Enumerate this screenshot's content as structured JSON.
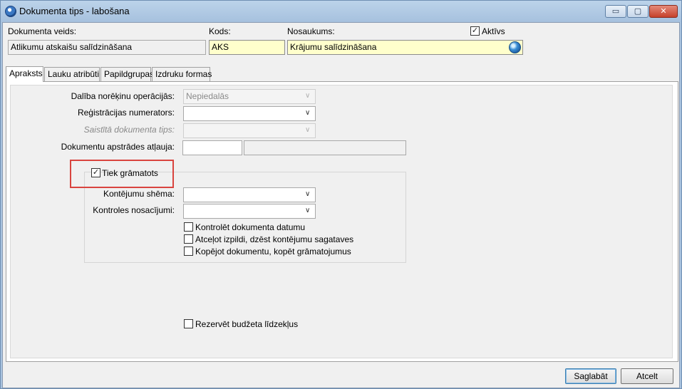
{
  "window": {
    "title": "Dokumenta tips - labošana",
    "minimize": "▭",
    "maximize": "▢",
    "close": "✕"
  },
  "header": {
    "doc_type_label": "Dokumenta veids:",
    "doc_type_value": "Atlikumu atskaišu salīdzināšana",
    "code_label": "Kods:",
    "code_value": "AKS",
    "name_label": "Nosaukums:",
    "name_value": "Krājumu salīdzināšana",
    "active_label": "Aktīvs",
    "active_checked": true
  },
  "tabs": [
    {
      "label": "Apraksts",
      "active": true
    },
    {
      "label": "Lauku atribūti",
      "active": false
    },
    {
      "label": "Papildgrupas",
      "active": false
    },
    {
      "label": "Izdruku formas",
      "active": false
    }
  ],
  "form": {
    "settlement_label": "Dalība norēķinu operācijās:",
    "settlement_value": "Nepiedalās",
    "registration_label": "Reģistrācijas numerators:",
    "registration_value": "",
    "linked_doc_label": "Saistītā dokumenta tips:",
    "linked_doc_value": "",
    "permission_label": "Dokumentu apstrādes atļauja:",
    "permission_code": "",
    "permission_name": ""
  },
  "posting_group": {
    "title": "Tiek grāmatots",
    "checked": true,
    "scheme_label": "Kontējumu shēma:",
    "scheme_value": "",
    "conditions_label": "Kontroles nosacījumi:",
    "conditions_value": "",
    "checks": [
      {
        "label": "Kontrolēt dokumenta datumu",
        "checked": false
      },
      {
        "label": "Atceļot izpildi, dzēst kontējumu sagataves",
        "checked": false
      },
      {
        "label": "Kopējot dokumentu, kopēt grāmatojumus",
        "checked": false
      }
    ]
  },
  "reserve": {
    "label": "Rezervēt budžeta līdzekļus",
    "checked": false
  },
  "buttons": {
    "save": "Saglabāt",
    "cancel": "Atcelt"
  },
  "check_glyph": "✓",
  "chevron_glyph": "∨"
}
